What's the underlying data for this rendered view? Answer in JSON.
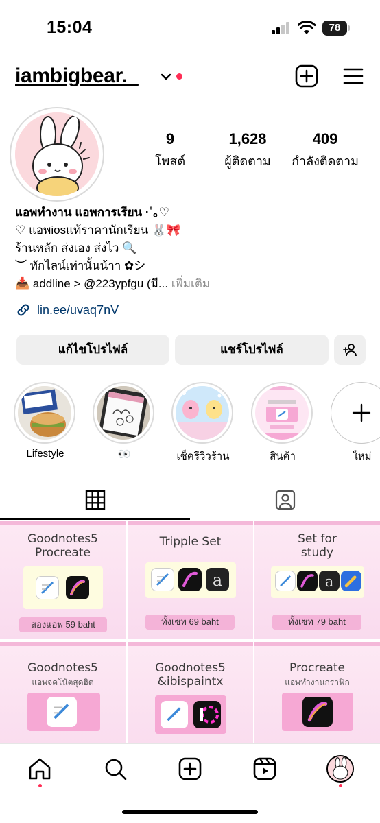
{
  "status_bar": {
    "time": "15:04",
    "battery": "78"
  },
  "header": {
    "username": "iambigbear._"
  },
  "stats": [
    {
      "count": "9",
      "label": "โพสต์"
    },
    {
      "count": "1,628",
      "label": "ผู้ติดตาม"
    },
    {
      "count": "409",
      "label": "กำลังติดตาม"
    }
  ],
  "bio": {
    "name": "แอพทำงาน แอพการเรียน ·˚｡♡",
    "line1": "♡ แอพiosแท้ราคานักเรียน 🐰🎀",
    "line2": "ร้านหลัก ส่งเอง ส่งไว 🔍",
    "line3": "︶ ทักไลน์เท่านั้นน้าา ✿シ",
    "line4": "📥 addline > @223ypfgu (มี...",
    "more": "เพิ่มเติม",
    "link": "lin.ee/uvaq7nV"
  },
  "buttons": {
    "edit": "แก้ไขโปรไฟล์",
    "share": "แชร์โปรไฟล์"
  },
  "highlights": [
    {
      "label": "Lifestyle"
    },
    {
      "label": "👀"
    },
    {
      "label": "เช็ครีวิวร้าน"
    },
    {
      "label": "สินค้า"
    },
    {
      "label": "ใหม่"
    }
  ],
  "posts": [
    {
      "title1": "Goodnotes5",
      "title2": "Procreate",
      "price": "สองแอพ 59 baht"
    },
    {
      "title1": "Tripple Set",
      "title2": "",
      "price": "ทั้งเซท 69 baht"
    },
    {
      "title1": "Set for",
      "title2": "study",
      "price": "ทั้งเซท 79 baht"
    },
    {
      "title1": "Goodnotes5",
      "title2": "แอพจดโน้ตสุดฮิต",
      "price": ""
    },
    {
      "title1": "Goodnotes5",
      "title2": "&ibispaintx",
      "price": ""
    },
    {
      "title1": "Procreate",
      "title2": "แอพทำงานกราฟิก",
      "price": ""
    }
  ],
  "colors": {
    "accent_dot": "#ff2d55",
    "link": "#00376b",
    "button_bg": "#efefef",
    "post_pink": "#f4b3d8"
  },
  "icons": [
    "chevron-down-icon",
    "new-post-icon",
    "menu-icon",
    "link-icon",
    "add-person-icon",
    "grid-icon",
    "tagged-icon",
    "home-icon",
    "search-icon",
    "create-icon",
    "reels-icon"
  ]
}
